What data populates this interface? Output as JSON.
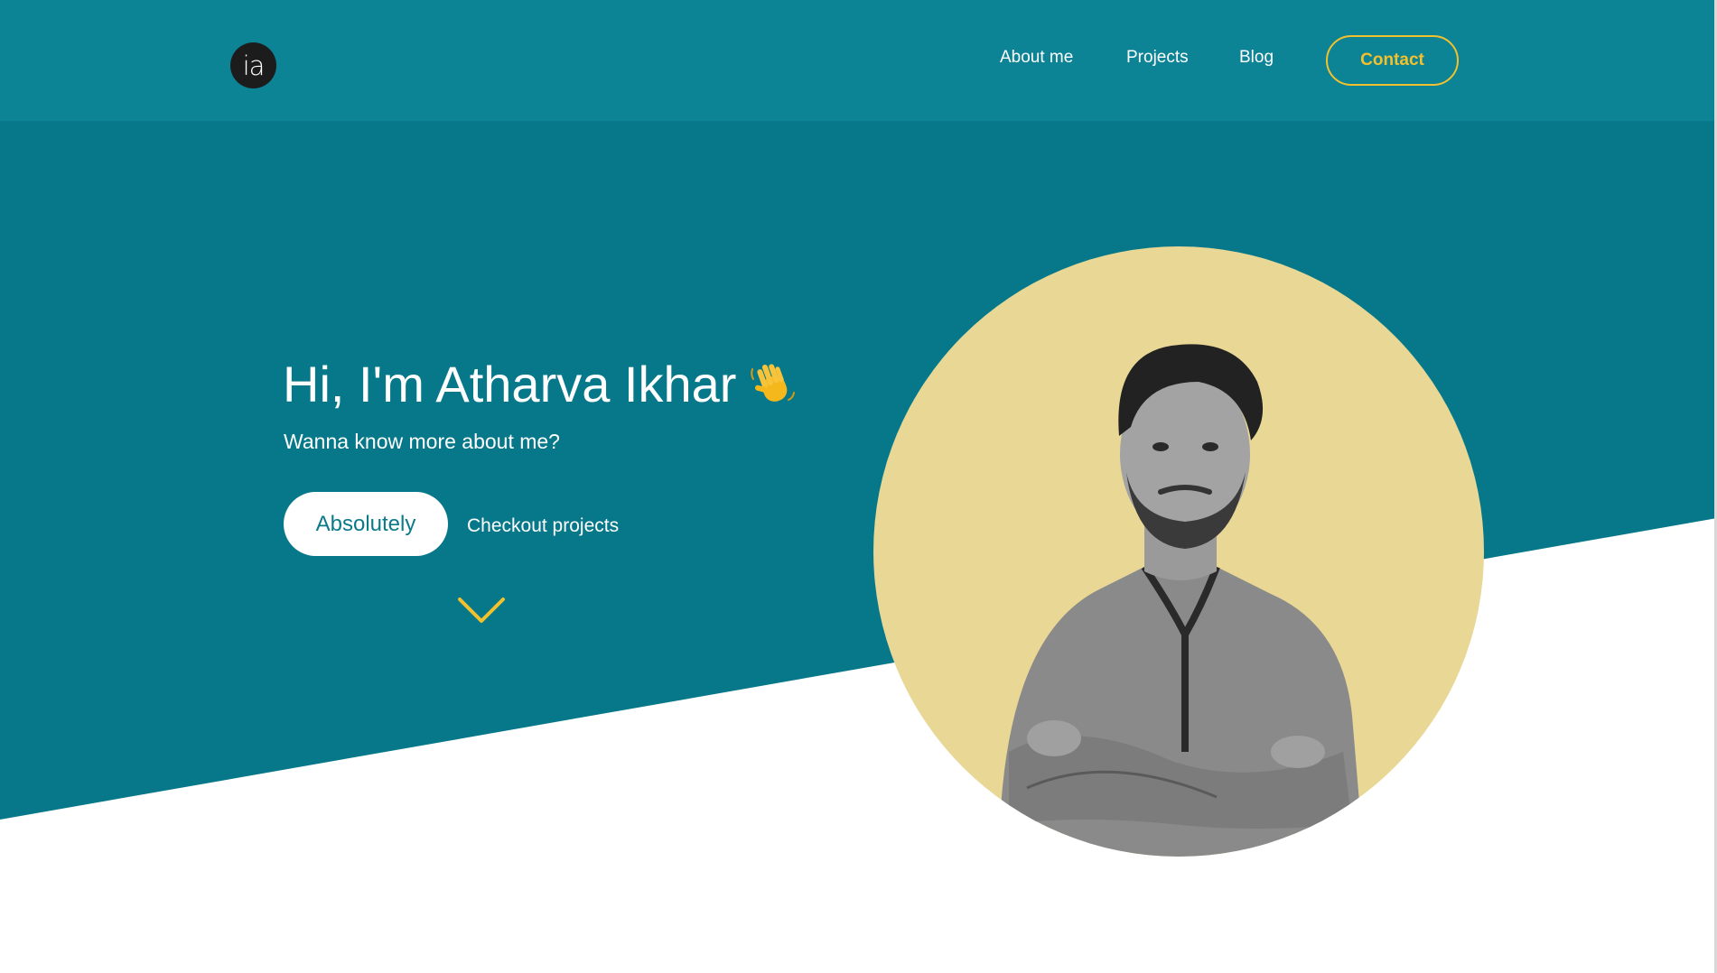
{
  "colors": {
    "navbar": "#0d8396",
    "hero": "#06788a",
    "accent": "#f2c12e",
    "portrait_bg": "#e8d795"
  },
  "nav": {
    "logo_text": "ia",
    "links": [
      {
        "label": "About me"
      },
      {
        "label": "Projects"
      },
      {
        "label": "Blog"
      }
    ],
    "contact_label": "Contact"
  },
  "hero": {
    "title": "Hi, I'm Atharva Ikhar",
    "title_icon": "waving-hand-icon",
    "subtitle": "Wanna know more about me?",
    "primary_button": "Absolutely",
    "secondary_link": "Checkout projects",
    "scroll_icon": "chevron-down-icon"
  },
  "portrait": {
    "icon": "profile-photo"
  }
}
